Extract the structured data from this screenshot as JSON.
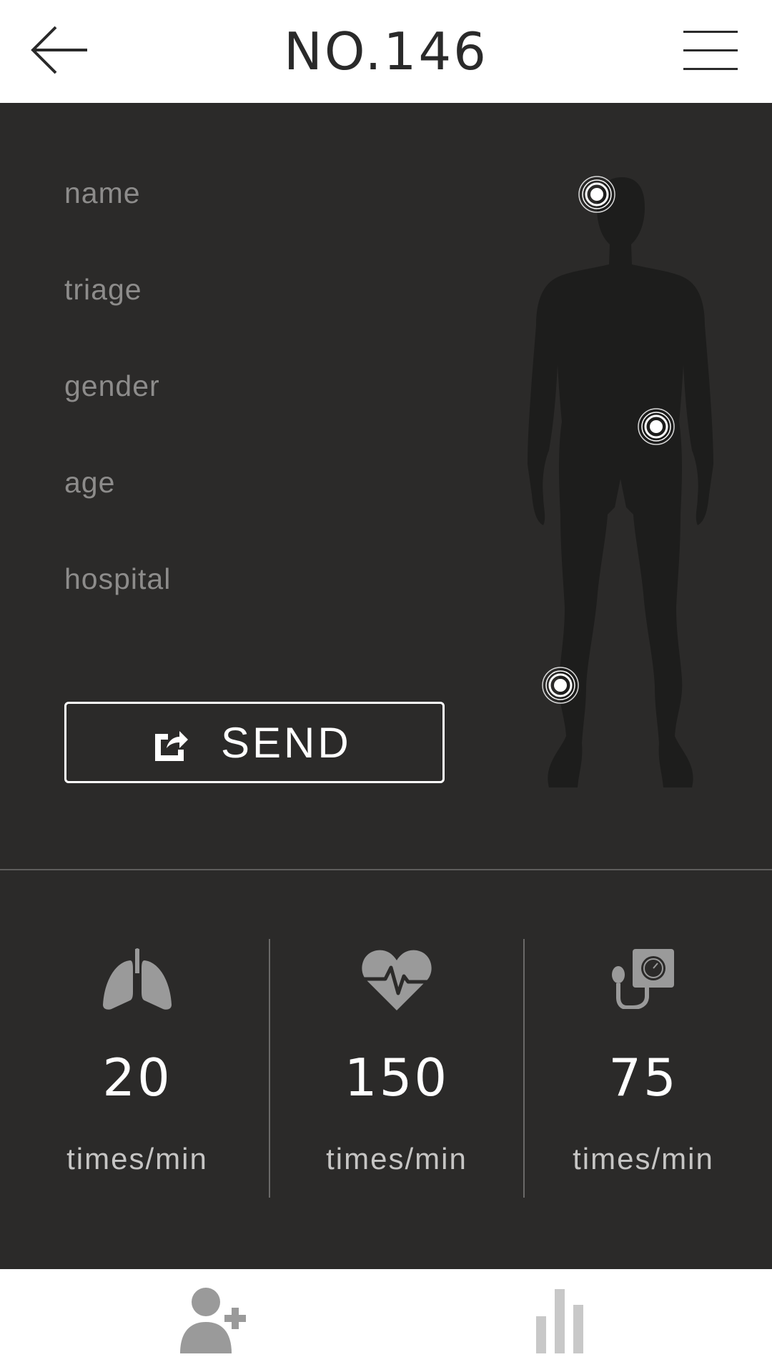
{
  "header": {
    "title": "NO.146",
    "back_icon": "arrow-left-icon",
    "menu_icon": "hamburger-menu-icon"
  },
  "patient": {
    "fields": [
      {
        "label": "name"
      },
      {
        "label": "triage"
      },
      {
        "label": "gender"
      },
      {
        "label": "age"
      },
      {
        "label": "hospital"
      }
    ],
    "send_button": {
      "label": "SEND",
      "icon": "share-icon"
    }
  },
  "body_map": {
    "figure": "human-body-silhouette",
    "markers": [
      "head",
      "right-hip",
      "left-lower-leg"
    ]
  },
  "vitals": [
    {
      "icon": "lungs-icon",
      "value": "20",
      "unit": "times/min"
    },
    {
      "icon": "heart-rate-icon",
      "value": "150",
      "unit": "times/min"
    },
    {
      "icon": "blood-pressure-icon",
      "value": "75",
      "unit": "times/min"
    }
  ],
  "tabbar": {
    "items": [
      {
        "icon": "add-user-icon"
      },
      {
        "icon": "bar-chart-icon"
      }
    ]
  },
  "colors": {
    "panel_bg": "#2b2a29",
    "header_bg": "#ffffff",
    "label_gray": "#8d8c8b",
    "icon_gray": "#9a9a9a",
    "silhouette": "#1d1d1c"
  }
}
